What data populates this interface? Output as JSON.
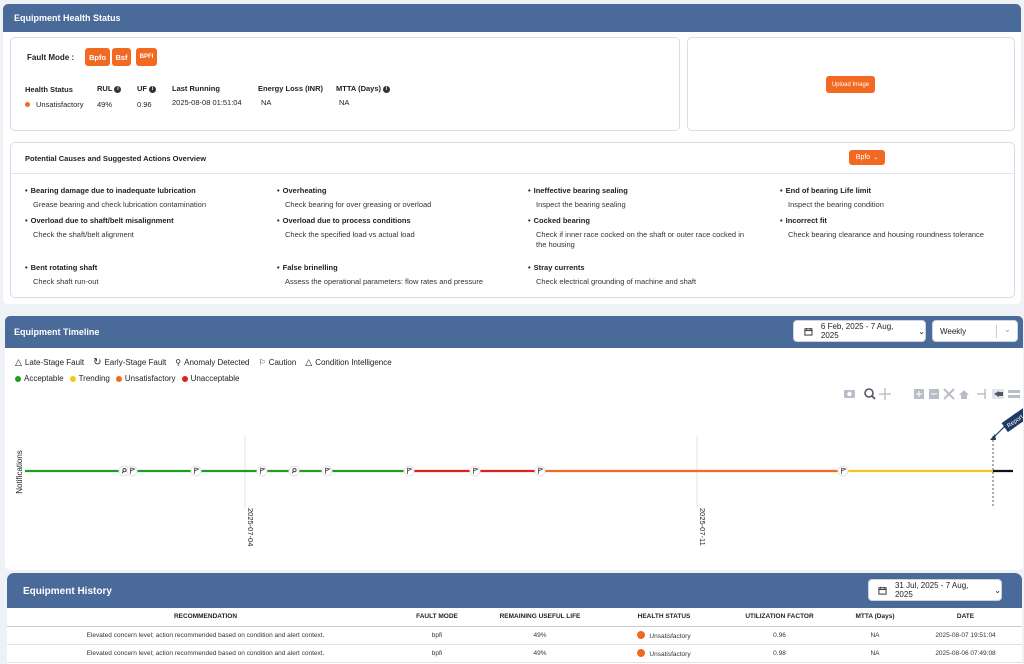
{
  "health": {
    "title": "Equipment Health Status",
    "fault_mode_label": "Fault Mode :",
    "fault_modes": [
      "Bpfo",
      "Bsf",
      "BPFI"
    ],
    "health_status_label": "Health Status",
    "health_status_value": "Unsatisfactory",
    "rul_label": "RUL",
    "rul_value": "49%",
    "uf_label": "UF",
    "uf_value": "0.96",
    "last_running_label": "Last Running",
    "last_running_value": "2025-08-08 01:51:04",
    "energy_loss_label": "Energy Loss (INR)",
    "energy_loss_value": "NA",
    "mtta_label": "MTTA (Days)",
    "mtta_value": "NA",
    "upload_label": "Upload Image",
    "status_color": "#f26a21"
  },
  "causes": {
    "title": "Potential Causes and Suggested Actions Overview",
    "selector": "Bpfo",
    "items": [
      {
        "title": "Bearing damage due to inadequate lubrication",
        "action": "Grease bearing and check lubrication contamination"
      },
      {
        "title": "Overheating",
        "action": "Check bearing for over greasing or overload"
      },
      {
        "title": "Ineffective bearing sealing",
        "action": "Inspect the bearing sealing"
      },
      {
        "title": "End of bearing Life limit",
        "action": "Inspect the bearing condition"
      },
      {
        "title": "Overload due to shaft/belt misalignment",
        "action": "Check the shaft/belt alignment"
      },
      {
        "title": "Overload due to process conditions",
        "action": "Check the specified load vs actual load"
      },
      {
        "title": "Cocked bearing",
        "action": "Check if inner race cocked on the shaft or outer race cocked in the housing"
      },
      {
        "title": "Incorrect fit",
        "action": "Check bearing clearance and housing roundness tolerance"
      },
      {
        "title": "Bent rotating shaft",
        "action": "Check shaft run-out"
      },
      {
        "title": "False brinelling",
        "action": "Assess the operational parameters: flow rates and pressure"
      },
      {
        "title": "Stray currents",
        "action": "Check electrical grounding of machine and shaft"
      }
    ]
  },
  "timeline": {
    "title": "Equipment Timeline",
    "date_range": "6 Feb, 2025 - 7 Aug, 2025",
    "period": "Weekly",
    "legend_types": [
      "Late-Stage Fault",
      "Early-Stage Fault",
      "Anomaly Detected",
      "Caution",
      "Condition Intelligence"
    ],
    "legend_status": [
      {
        "label": "Acceptable",
        "color": "#1e9e1e"
      },
      {
        "label": "Trending",
        "color": "#f2c81e"
      },
      {
        "label": "Unsatisfactory",
        "color": "#f26a21"
      },
      {
        "label": "Unacceptable",
        "color": "#e0201e"
      }
    ],
    "y_label": "Notifications",
    "x_ticks": [
      "2025-07-04",
      "2025-07-11"
    ],
    "flag_label": "Report"
  },
  "history": {
    "title": "Equipment History",
    "date_range": "31 Jul, 2025 - 7 Aug, 2025",
    "columns": [
      "RECOMMENDATION",
      "FAULT MODE",
      "REMAINING USEFUL LIFE",
      "HEALTH STATUS",
      "UTILIZATION FACTOR",
      "MTTA (Days)",
      "DATE"
    ],
    "rows": [
      [
        "Elevated concern level; action recommended based on condition and alert context.",
        "bpfi",
        "49%",
        "Unsatisfactory",
        "0.96",
        "NA",
        "2025-08-07 19:51:04"
      ],
      [
        "Elevated concern level; action recommended based on condition and alert context.",
        "bpfi",
        "49%",
        "Unsatisfactory",
        "0.98",
        "NA",
        "2025-08-06 07:49:08"
      ]
    ]
  }
}
